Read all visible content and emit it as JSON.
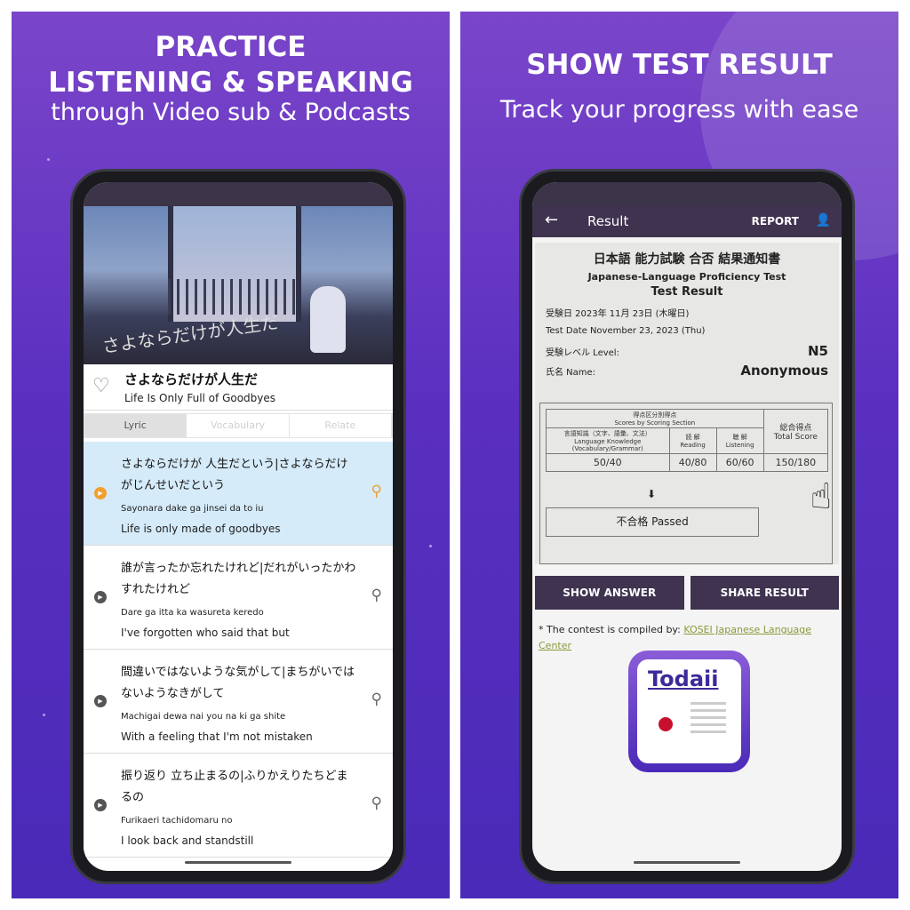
{
  "left_panel": {
    "headline_1": "PRACTICE",
    "headline_2": "LISTENING & SPEAKING",
    "subhead": "through Video sub & Podcasts"
  },
  "right_panel": {
    "headline": "SHOW TEST RESULT",
    "subhead": "Track your progress with ease"
  },
  "player": {
    "video_overlay_text": "さよならだけが人生だ",
    "song_title_jp": "さよならだけが人生だ",
    "song_title_en": "Life Is Only Full of Goodbyes",
    "tabs": [
      {
        "label": "Lyric",
        "active": true
      },
      {
        "label": "Vocabulary"
      },
      {
        "label": "Relate"
      }
    ],
    "lyrics": [
      {
        "jp": "さよならだけが 人生だという|さよならだけがじんせいだという",
        "romaji": "Sayonara dake ga jinsei da to iu",
        "en": "Life is only made of goodbyes",
        "active": true
      },
      {
        "jp": "誰が言ったか忘れたけれど|だれがいったかわすれたけれど",
        "romaji": "Dare ga itta ka wasureta keredo",
        "en": "I've forgotten who said that but"
      },
      {
        "jp": "間違いではないような気がして|まちがいではないようなきがして",
        "romaji": "Machigai dewa nai you na ki ga shite",
        "en": "With a feeling that I'm not mistaken"
      },
      {
        "jp": "振り返り 立ち止まるの|ふりかえりたちどまるの",
        "romaji": "Furikaeri tachidomaru no",
        "en": "I look back and standstill"
      }
    ]
  },
  "result": {
    "title": "Result",
    "report": "REPORT",
    "doc_title_jp": "日本語 能力試験 合否 結果通知書",
    "doc_title_en": "Japanese-Language Proficiency Test",
    "doc_subtitle": "Test Result",
    "date_jp": "受験日 2023年 11月 23日 (木曜日)",
    "date_en": "Test Date November 23, 2023 (Thu)",
    "level_label": "受験レベル Level:",
    "level": "N5",
    "name_label": "氏名 Name:",
    "name": "Anonymous",
    "section_header_jp": "得点区分別得点",
    "section_header_en": "Scores by Scoring Section",
    "lk_jp": "言語知識（文字、語彙、文法）",
    "lk_en": "Language Knowledge",
    "lk_en2": "(Vocabulary/Grammar)",
    "reading_jp": "読 解",
    "reading_en": "Reading",
    "listening_jp": "聴 解",
    "listening_en": "Listening",
    "total_jp": "総合得点",
    "total_en": "Total Score",
    "lk_score": "50/40",
    "reading_score": "40/80",
    "listening_score": "60/60",
    "total_score": "150/180",
    "verdict": "不合格 Passed",
    "show_answer": "SHOW ANSWER",
    "share_result": "SHARE RESULT",
    "note_prefix": "* The contest is compiled by: ",
    "note_link": "KOSEI Japanese Language Center",
    "logo_text": "Todaii"
  },
  "colors": {
    "panel": "#5a2fc0",
    "appbar": "#3f3350",
    "active_lyric": "#d5ebf9",
    "accent": "#f0a030"
  }
}
